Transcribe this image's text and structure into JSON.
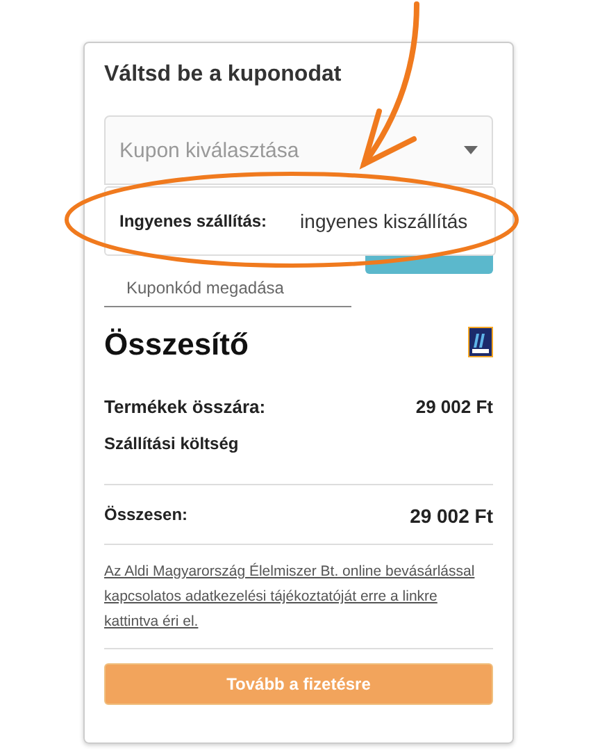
{
  "coupon": {
    "title": "Váltsd be a kuponodat",
    "select": {
      "placeholder": "Kupon kiválasztása",
      "expanded": true
    },
    "options": [
      {
        "label": "Ingyenes szállítás:",
        "value": "ingyenes kiszállítás"
      }
    ],
    "code_field": {
      "placeholder": "Kuponkód megadása"
    }
  },
  "summary": {
    "title": "Összesítő",
    "rows": [
      {
        "label": "Termékek összára:",
        "value": "29 002 Ft"
      },
      {
        "label": "Szállítási költség"
      }
    ],
    "total": {
      "label": "Összesen:",
      "value": "29 002 Ft"
    },
    "privacy_link": "Az Aldi Magyarország Élelmiszer Bt. online bevásárlással kapcsolatos adatkezelési tájékoztatóját erre a linkre kattintva éri el.",
    "checkout_button": "Tovább a fizetésre"
  }
}
